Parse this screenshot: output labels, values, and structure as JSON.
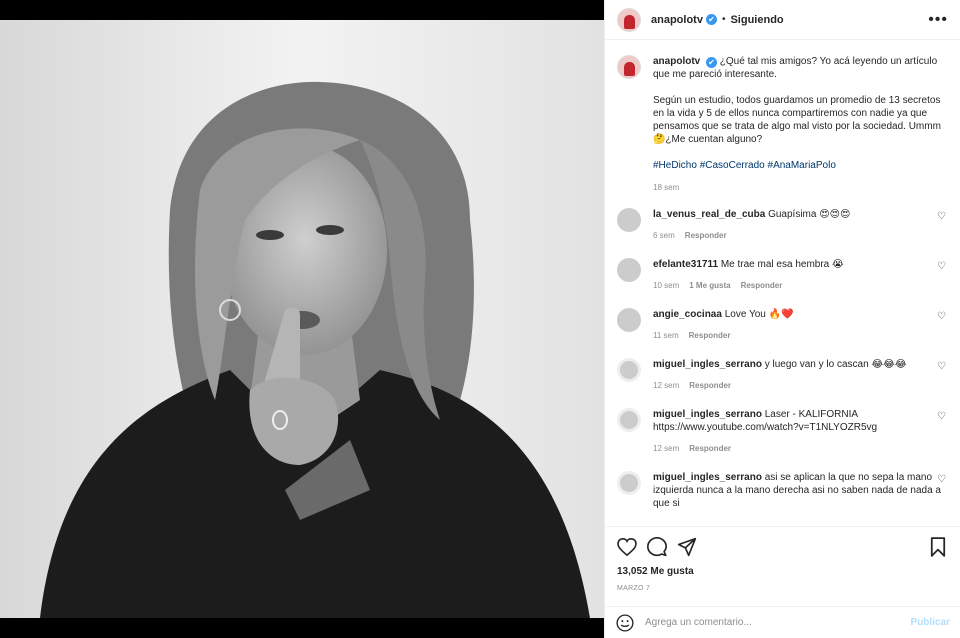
{
  "post": {
    "username": "anapolotv",
    "verified_mark": "✔",
    "separator": "•",
    "follow_status": "Siguiendo",
    "more_glyph": "•••"
  },
  "caption": {
    "username": "anapolotv",
    "line1": "¿Qué tal mis amigos? Yo acá leyendo un artículo que me pareció interesante.",
    "line2": "Según un estudio, todos guardamos un promedio de 13 secretos en la vida y 5 de ellos nunca compartiremos con nadie ya que pensamos que se trata de algo mal visto por la sociedad. Ummm 🤔¿Me cuentan alguno?",
    "hashtags": "#HeDicho #CasoCerrado #AnaMariaPolo",
    "time": "18 sem"
  },
  "comments": [
    {
      "username": "la_venus_real_de_cuba",
      "text": "Guapísima 😍😍😍",
      "time": "6 sem",
      "likes": "",
      "reply": "Responder"
    },
    {
      "username": "efelante31711",
      "text": "Me trae mal esa hembra 😭",
      "time": "10 sem",
      "likes": "1 Me gusta",
      "reply": "Responder"
    },
    {
      "username": "angie_cocinaa",
      "text": "Love You 🔥❤️",
      "time": "11 sem",
      "likes": "",
      "reply": "Responder"
    },
    {
      "username": "miguel_ingles_serrano",
      "text": "y luego van y lo cascan 😂😂😂",
      "time": "12 sem",
      "likes": "",
      "reply": "Responder"
    },
    {
      "username": "miguel_ingles_serrano",
      "text": "Laser - KALIFORNIA https://www.youtube.com/watch?v=T1NLYOZR5vg",
      "time": "12 sem",
      "likes": "",
      "reply": "Responder"
    },
    {
      "username": "miguel_ingles_serrano",
      "text": "asi se aplican la que no sepa la mano izquierda nunca a la mano derecha asi no saben nada de nada a que si",
      "time": "",
      "likes": "",
      "reply": ""
    }
  ],
  "stats": {
    "likes": "13,052 Me gusta",
    "date": "MARZO 7"
  },
  "add_comment": {
    "placeholder": "Agrega un comentario...",
    "publish": "Publicar"
  },
  "icons": [
    "heart-icon",
    "comment-icon",
    "share-icon",
    "bookmark-icon",
    "emoji-icon",
    "more-icon"
  ]
}
